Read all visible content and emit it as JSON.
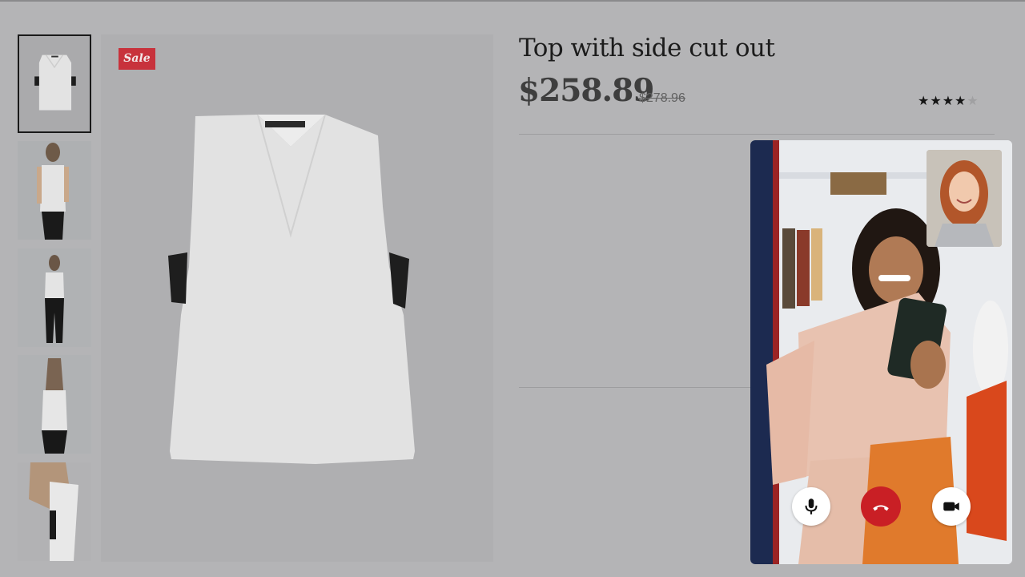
{
  "product": {
    "title": "Top with side cut out",
    "price": "$258.89",
    "original_price": "$278.96",
    "sale_badge": "Sale",
    "rating": 4,
    "rating_max": 5
  },
  "gallery": {
    "thumbnail_count": 5,
    "selected_index": 0,
    "thumbnails": [
      "product-flat-thumbnail",
      "model-front-thumbnail",
      "model-full-thumbnail",
      "model-back-thumbnail",
      "model-side-thumbnail"
    ]
  },
  "video_call": {
    "controls": [
      "microphone-icon",
      "end-call-icon",
      "camera-icon"
    ],
    "colors": {
      "end_call": "#c91f25",
      "control_bg": "#ffffff"
    }
  },
  "colors": {
    "sale_badge": "#c8323c",
    "overlay": "#b4b4b6",
    "star_filled": "#151515",
    "star_empty": "#a0a0a2"
  }
}
